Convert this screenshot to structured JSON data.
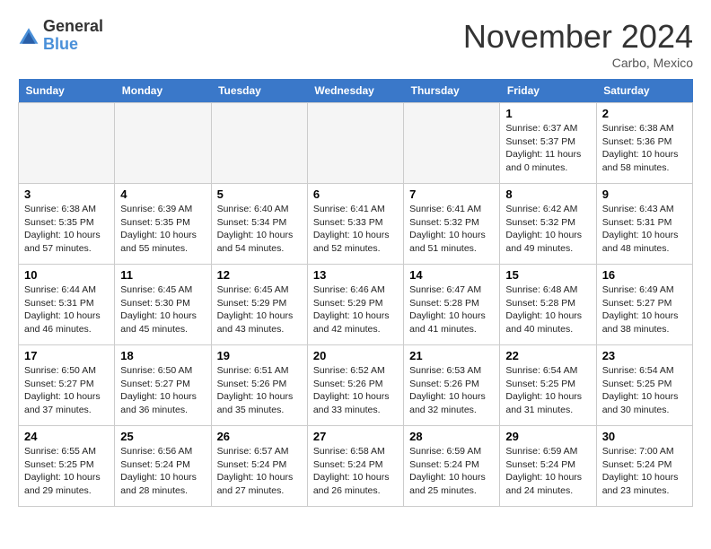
{
  "header": {
    "logo_general": "General",
    "logo_blue": "Blue",
    "month_title": "November 2024",
    "location": "Carbo, Mexico"
  },
  "weekdays": [
    "Sunday",
    "Monday",
    "Tuesday",
    "Wednesday",
    "Thursday",
    "Friday",
    "Saturday"
  ],
  "weeks": [
    [
      {
        "day": "",
        "empty": true
      },
      {
        "day": "",
        "empty": true
      },
      {
        "day": "",
        "empty": true
      },
      {
        "day": "",
        "empty": true
      },
      {
        "day": "",
        "empty": true
      },
      {
        "day": "1",
        "sunrise": "Sunrise: 6:37 AM",
        "sunset": "Sunset: 5:37 PM",
        "daylight": "Daylight: 11 hours and 0 minutes."
      },
      {
        "day": "2",
        "sunrise": "Sunrise: 6:38 AM",
        "sunset": "Sunset: 5:36 PM",
        "daylight": "Daylight: 10 hours and 58 minutes."
      }
    ],
    [
      {
        "day": "3",
        "sunrise": "Sunrise: 6:38 AM",
        "sunset": "Sunset: 5:35 PM",
        "daylight": "Daylight: 10 hours and 57 minutes."
      },
      {
        "day": "4",
        "sunrise": "Sunrise: 6:39 AM",
        "sunset": "Sunset: 5:35 PM",
        "daylight": "Daylight: 10 hours and 55 minutes."
      },
      {
        "day": "5",
        "sunrise": "Sunrise: 6:40 AM",
        "sunset": "Sunset: 5:34 PM",
        "daylight": "Daylight: 10 hours and 54 minutes."
      },
      {
        "day": "6",
        "sunrise": "Sunrise: 6:41 AM",
        "sunset": "Sunset: 5:33 PM",
        "daylight": "Daylight: 10 hours and 52 minutes."
      },
      {
        "day": "7",
        "sunrise": "Sunrise: 6:41 AM",
        "sunset": "Sunset: 5:32 PM",
        "daylight": "Daylight: 10 hours and 51 minutes."
      },
      {
        "day": "8",
        "sunrise": "Sunrise: 6:42 AM",
        "sunset": "Sunset: 5:32 PM",
        "daylight": "Daylight: 10 hours and 49 minutes."
      },
      {
        "day": "9",
        "sunrise": "Sunrise: 6:43 AM",
        "sunset": "Sunset: 5:31 PM",
        "daylight": "Daylight: 10 hours and 48 minutes."
      }
    ],
    [
      {
        "day": "10",
        "sunrise": "Sunrise: 6:44 AM",
        "sunset": "Sunset: 5:31 PM",
        "daylight": "Daylight: 10 hours and 46 minutes."
      },
      {
        "day": "11",
        "sunrise": "Sunrise: 6:45 AM",
        "sunset": "Sunset: 5:30 PM",
        "daylight": "Daylight: 10 hours and 45 minutes."
      },
      {
        "day": "12",
        "sunrise": "Sunrise: 6:45 AM",
        "sunset": "Sunset: 5:29 PM",
        "daylight": "Daylight: 10 hours and 43 minutes."
      },
      {
        "day": "13",
        "sunrise": "Sunrise: 6:46 AM",
        "sunset": "Sunset: 5:29 PM",
        "daylight": "Daylight: 10 hours and 42 minutes."
      },
      {
        "day": "14",
        "sunrise": "Sunrise: 6:47 AM",
        "sunset": "Sunset: 5:28 PM",
        "daylight": "Daylight: 10 hours and 41 minutes."
      },
      {
        "day": "15",
        "sunrise": "Sunrise: 6:48 AM",
        "sunset": "Sunset: 5:28 PM",
        "daylight": "Daylight: 10 hours and 40 minutes."
      },
      {
        "day": "16",
        "sunrise": "Sunrise: 6:49 AM",
        "sunset": "Sunset: 5:27 PM",
        "daylight": "Daylight: 10 hours and 38 minutes."
      }
    ],
    [
      {
        "day": "17",
        "sunrise": "Sunrise: 6:50 AM",
        "sunset": "Sunset: 5:27 PM",
        "daylight": "Daylight: 10 hours and 37 minutes."
      },
      {
        "day": "18",
        "sunrise": "Sunrise: 6:50 AM",
        "sunset": "Sunset: 5:27 PM",
        "daylight": "Daylight: 10 hours and 36 minutes."
      },
      {
        "day": "19",
        "sunrise": "Sunrise: 6:51 AM",
        "sunset": "Sunset: 5:26 PM",
        "daylight": "Daylight: 10 hours and 35 minutes."
      },
      {
        "day": "20",
        "sunrise": "Sunrise: 6:52 AM",
        "sunset": "Sunset: 5:26 PM",
        "daylight": "Daylight: 10 hours and 33 minutes."
      },
      {
        "day": "21",
        "sunrise": "Sunrise: 6:53 AM",
        "sunset": "Sunset: 5:26 PM",
        "daylight": "Daylight: 10 hours and 32 minutes."
      },
      {
        "day": "22",
        "sunrise": "Sunrise: 6:54 AM",
        "sunset": "Sunset: 5:25 PM",
        "daylight": "Daylight: 10 hours and 31 minutes."
      },
      {
        "day": "23",
        "sunrise": "Sunrise: 6:54 AM",
        "sunset": "Sunset: 5:25 PM",
        "daylight": "Daylight: 10 hours and 30 minutes."
      }
    ],
    [
      {
        "day": "24",
        "sunrise": "Sunrise: 6:55 AM",
        "sunset": "Sunset: 5:25 PM",
        "daylight": "Daylight: 10 hours and 29 minutes."
      },
      {
        "day": "25",
        "sunrise": "Sunrise: 6:56 AM",
        "sunset": "Sunset: 5:24 PM",
        "daylight": "Daylight: 10 hours and 28 minutes."
      },
      {
        "day": "26",
        "sunrise": "Sunrise: 6:57 AM",
        "sunset": "Sunset: 5:24 PM",
        "daylight": "Daylight: 10 hours and 27 minutes."
      },
      {
        "day": "27",
        "sunrise": "Sunrise: 6:58 AM",
        "sunset": "Sunset: 5:24 PM",
        "daylight": "Daylight: 10 hours and 26 minutes."
      },
      {
        "day": "28",
        "sunrise": "Sunrise: 6:59 AM",
        "sunset": "Sunset: 5:24 PM",
        "daylight": "Daylight: 10 hours and 25 minutes."
      },
      {
        "day": "29",
        "sunrise": "Sunrise: 6:59 AM",
        "sunset": "Sunset: 5:24 PM",
        "daylight": "Daylight: 10 hours and 24 minutes."
      },
      {
        "day": "30",
        "sunrise": "Sunrise: 7:00 AM",
        "sunset": "Sunset: 5:24 PM",
        "daylight": "Daylight: 10 hours and 23 minutes."
      }
    ]
  ]
}
